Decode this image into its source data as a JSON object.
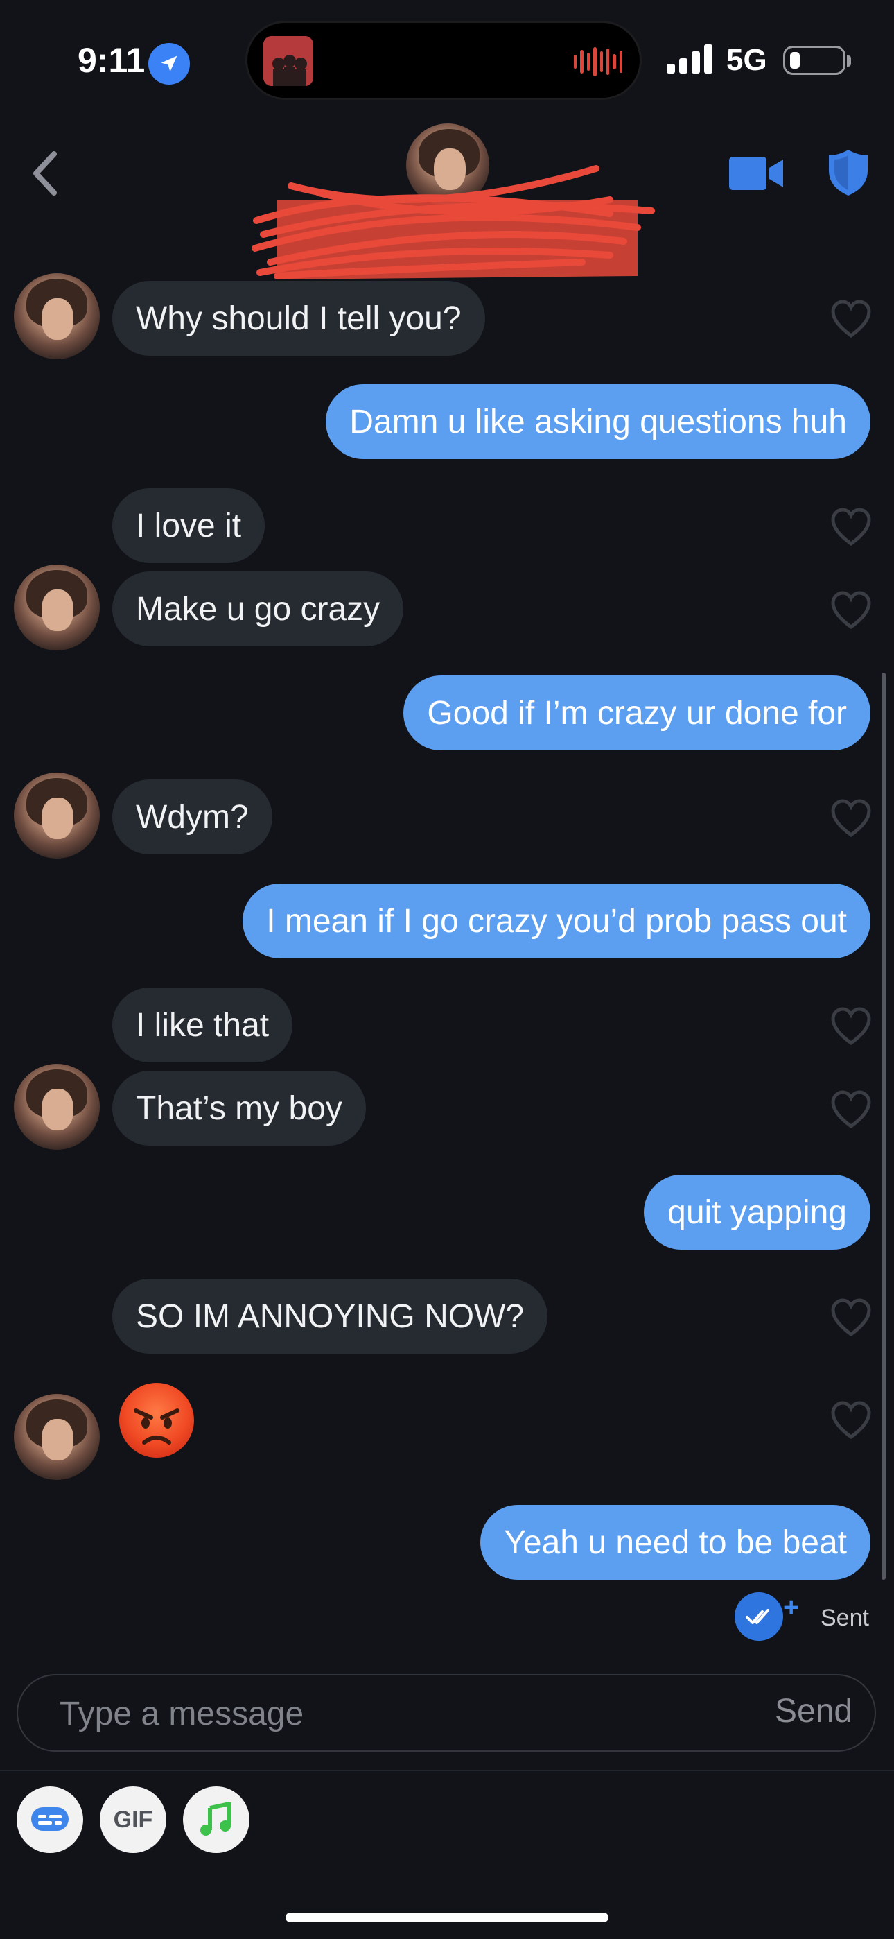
{
  "status_bar": {
    "time": "9:11",
    "network": "5G",
    "location_icon": "location-arrow-icon",
    "signal_icon": "cellular-signal-icon",
    "battery_icon": "battery-low-icon"
  },
  "header": {
    "back_icon": "chevron-left-icon",
    "video_icon": "video-camera-icon",
    "safety_icon": "shield-icon"
  },
  "messages": [
    {
      "sender": "them",
      "text": "Why should I tell you?"
    },
    {
      "sender": "me",
      "text": "Damn u like asking questions huh"
    },
    {
      "sender": "them",
      "text": "I love it"
    },
    {
      "sender": "them",
      "text": "Make u go crazy"
    },
    {
      "sender": "me",
      "text": "Good if I’m crazy ur done for"
    },
    {
      "sender": "them",
      "text": "Wdym?"
    },
    {
      "sender": "me",
      "text": "I mean if I go crazy you’d prob pass out"
    },
    {
      "sender": "them",
      "text": "I like that"
    },
    {
      "sender": "them",
      "text": "That’s my boy"
    },
    {
      "sender": "me",
      "text": "quit yapping"
    },
    {
      "sender": "them",
      "text": "SO IM ANNOYING NOW?"
    },
    {
      "sender": "them",
      "text": "😡",
      "type": "emoji"
    },
    {
      "sender": "me",
      "text": "Yeah u need to be beat"
    }
  ],
  "receipt": {
    "label": "Sent",
    "icon": "double-check-icon"
  },
  "composer": {
    "placeholder": "Type a message",
    "send_label": "Send",
    "tools": [
      {
        "icon": "chat-card-icon"
      },
      {
        "label": "GIF"
      },
      {
        "icon": "music-note-icon"
      }
    ]
  },
  "colors": {
    "background": "#111318",
    "incoming_bubble": "#262a31",
    "outgoing_bubble": "#5c9ef0",
    "accent": "#2f75e0"
  }
}
